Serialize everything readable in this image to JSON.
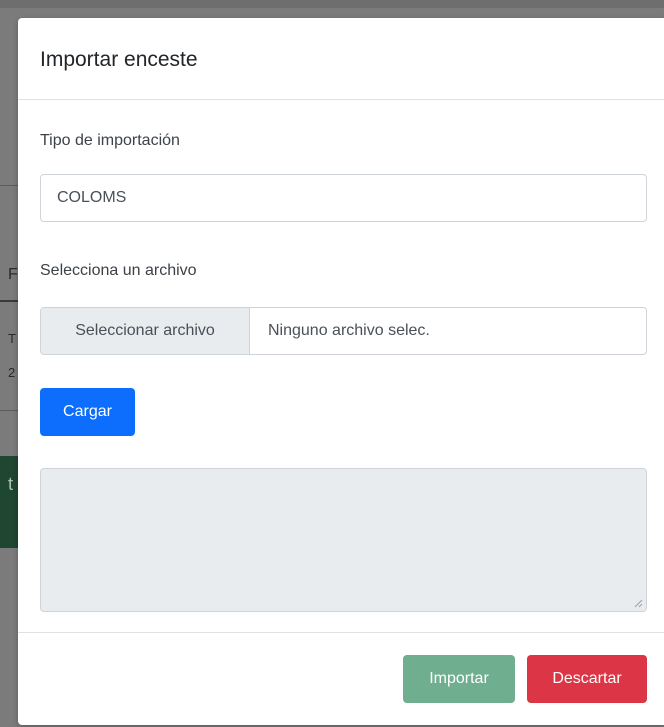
{
  "background": {
    "letters": [
      "F",
      "T",
      "2",
      "t"
    ],
    "colors": {
      "overlay": "#7b7b7b",
      "green_panel": "#1f4630"
    }
  },
  "modal": {
    "title": "Importar enceste",
    "import_type": {
      "label": "Tipo de importación",
      "value": "COLOMS"
    },
    "file": {
      "label": "Selecciona un archivo",
      "button_label": "Seleccionar archivo",
      "file_name": "Ninguno archivo selec."
    },
    "load_button": "Cargar",
    "output_textarea": {
      "value": "",
      "disabled": true
    },
    "footer": {
      "import_button": "Importar",
      "discard_button": "Descartar"
    },
    "colors": {
      "primary": "#0d6efd",
      "success_disabled": "#6fae8e",
      "danger": "#dc3545"
    }
  }
}
